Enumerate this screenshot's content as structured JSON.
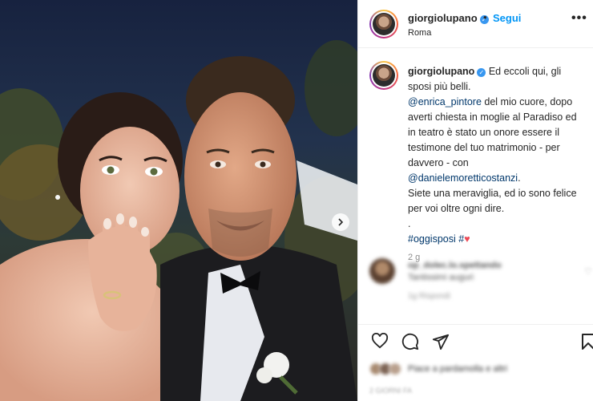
{
  "post": {
    "author": {
      "username": "giorgiolupano",
      "verified_mark": "✓",
      "location": "Roma",
      "follow_label": "Segui",
      "separator": "•",
      "more_label": "•••"
    },
    "caption": {
      "username": "giorgiolupano",
      "line1": "Ed eccoli qui, gli sposi più belli.",
      "mention1": "@enrica_pintore",
      "text2": " del mio cuore, dopo averti chiesta in moglie al Paradiso ed in teatro è stato un onore essere il testimone del tuo matrimonio - per davvero - con ",
      "mention2": "@danielemoretticostanzi",
      "text3": ".",
      "line4": "Siete una meraviglia, ed io sono felice per voi oltre ogni dire.",
      "dot_line": ".",
      "hashtag": "#oggisposi",
      "hash_suffix": " #",
      "heart": "♥",
      "timestamp": "2 g"
    },
    "comment": {
      "username_blurred": "op_dolec.lo.spettando",
      "text_blurred": "Tantissimi auguri",
      "meta_blurred": "1g    Rispondi"
    },
    "actions": {
      "like_icon": "heart-outline-icon",
      "comment_icon": "speech-bubble-icon",
      "share_icon": "paper-plane-icon",
      "save_icon": "bookmark-icon"
    },
    "likes": {
      "text_blurred": "Piace a pardamolla e altri",
      "date_blurred": "2 GIORNI FA"
    },
    "colors": {
      "link_blue": "#0095f6",
      "mention_blue": "#00376b",
      "heart_red": "#ed4956",
      "verified_blue": "#3897f0"
    }
  }
}
